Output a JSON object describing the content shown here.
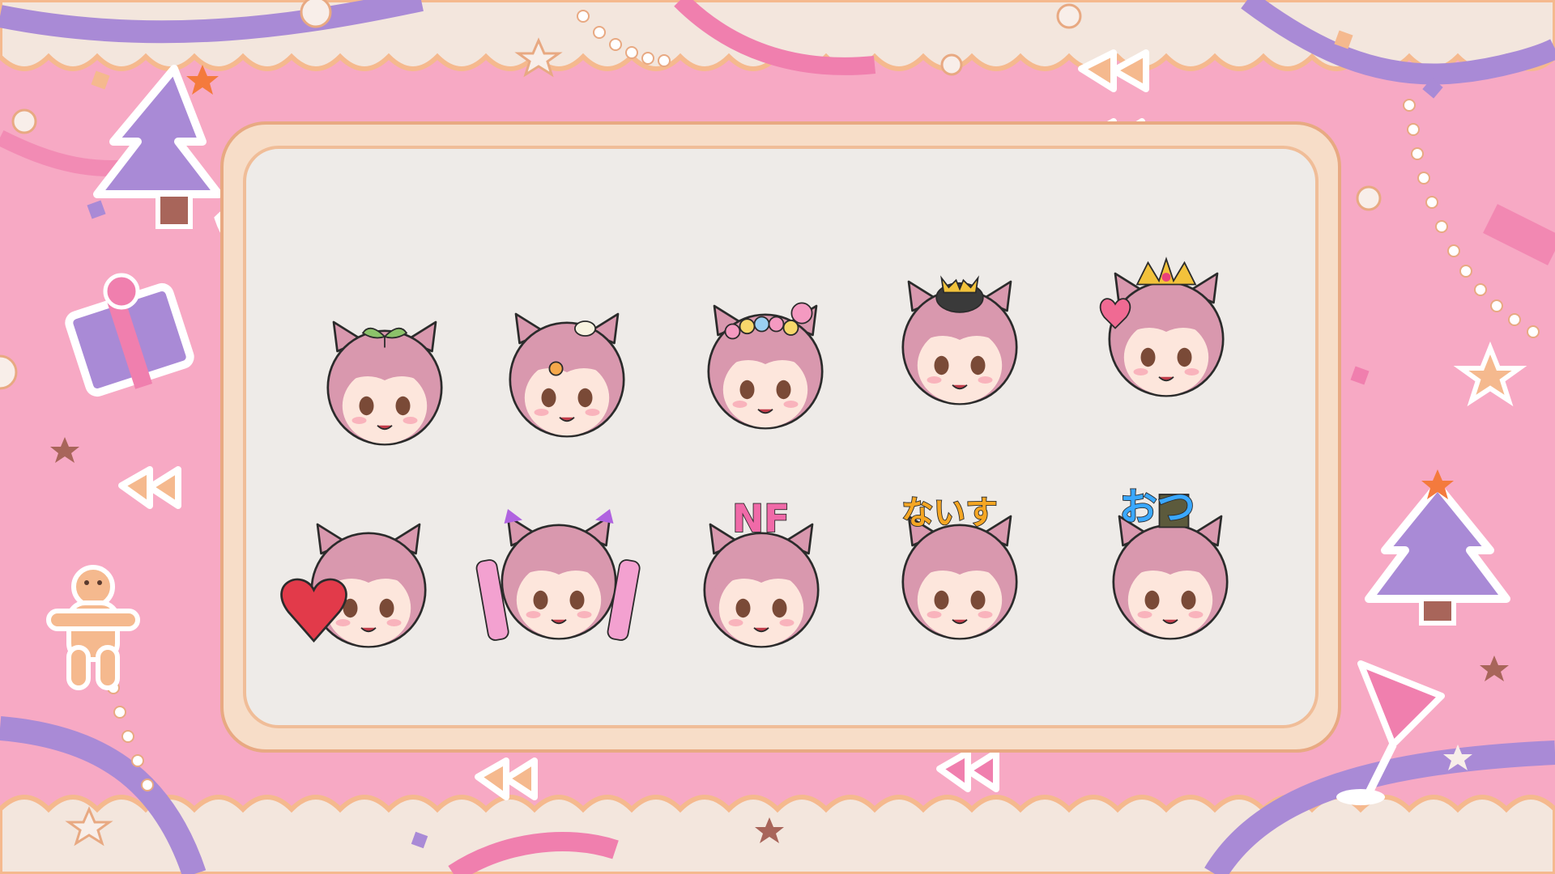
{
  "scene": {
    "title": "",
    "colors": {
      "background": "#f7a9c4",
      "panel": "#eeebe8",
      "frame_outer": "#f7ddc8",
      "frame_border": "#f0bd98",
      "ribbon_purple": "#a98ad6",
      "ribbon_pink": "#f07fae",
      "lace_top": "#f3e6dd",
      "lace_orange": "#f5b98e",
      "hair": "#d998ae",
      "skin": "#fde6dc",
      "eye": "#7a4a37",
      "cat_black": "#3a3a3a",
      "crown": "#f2c23b"
    }
  },
  "emotes": [
    {
      "name": "emote-sprout-peek",
      "text": ""
    },
    {
      "name": "emote-flower-smile",
      "text": ""
    },
    {
      "name": "emote-flower-crown-cat",
      "text": ""
    },
    {
      "name": "emote-cat-hat-happy",
      "text": ""
    },
    {
      "name": "emote-crown-cat-love",
      "text": ""
    },
    {
      "name": "emote-heart-wink",
      "text": ""
    },
    {
      "name": "emote-glowstick-cheer",
      "text": ""
    },
    {
      "name": "emote-nf-point",
      "text": "NF"
    },
    {
      "name": "emote-naisu-point",
      "text": "ないす"
    },
    {
      "name": "emote-otsu-tea",
      "text": "おつ"
    }
  ],
  "decorations": [
    {
      "name": "christmas-tree-icon"
    },
    {
      "name": "gift-box-icon"
    },
    {
      "name": "holly-icon"
    },
    {
      "name": "gingerbread-man-icon"
    },
    {
      "name": "cocktail-glass-icon"
    },
    {
      "name": "bow-ribbon-icon"
    },
    {
      "name": "star-icon"
    },
    {
      "name": "pearl-garland"
    }
  ]
}
